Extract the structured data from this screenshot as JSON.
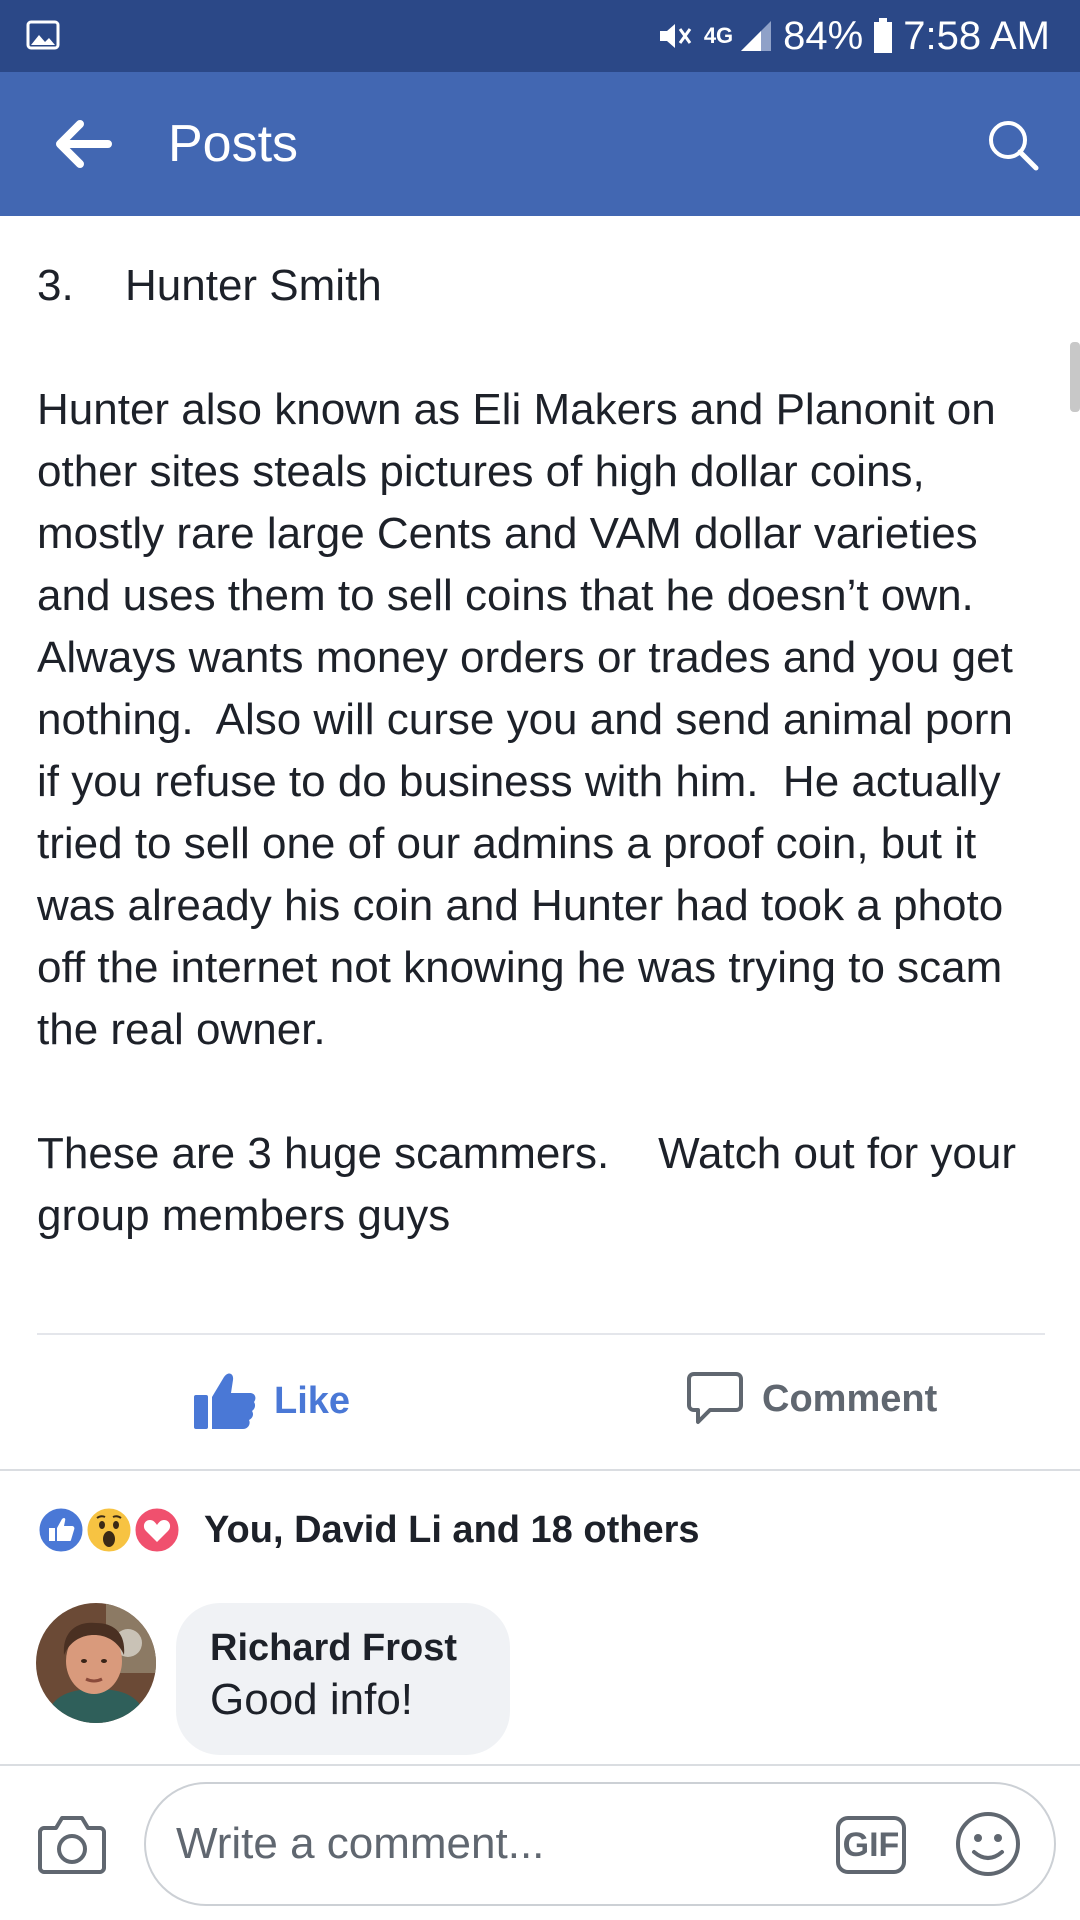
{
  "status_bar": {
    "network": "4G",
    "battery": "84%",
    "time": "7:58 AM"
  },
  "app_bar": {
    "title": "Posts"
  },
  "post": {
    "heading_number": "3.",
    "heading_name": "Hunter Smith",
    "paragraph1": "Hunter also known as Eli Makers and Planonit on other sites steals pictures of high dollar coins, mostly rare large Cents and VAM dollar varieties and uses them to sell coins that he doesn’t own. Always wants money orders or trades and you get nothing.  Also will curse you and send animal porn if you refuse to do business with him.  He actually tried to sell one of our admins a proof coin, but it was already his coin and Hunter had took a photo off the internet not knowing he was trying to scam the real owner.",
    "paragraph2": "These are 3 huge scammers.    Watch out for your group members guys"
  },
  "actions": {
    "like_label": "Like",
    "comment_label": "Comment"
  },
  "reactions": {
    "summary": "You, David Li and 18 others",
    "colors": {
      "like": "#4a78d6",
      "wow": "#f7c342",
      "love": "#f0506e"
    }
  },
  "comments": [
    {
      "author": "Richard Frost",
      "text": "Good info!"
    }
  ],
  "composer": {
    "placeholder": "Write a comment...",
    "gif_label": "GIF"
  },
  "colors": {
    "status_bar": "#2b4887",
    "app_bar": "#4267b2",
    "accent": "#4a78d6"
  }
}
